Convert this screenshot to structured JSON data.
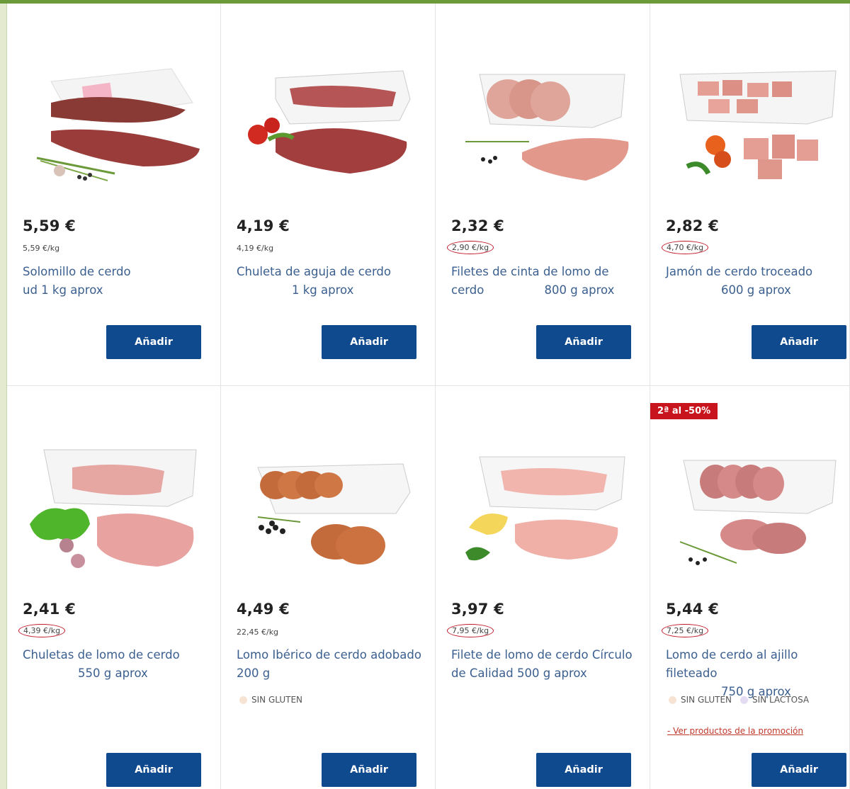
{
  "products": [
    {
      "price": "5,59 €",
      "unit_price": "5,59 €/kg",
      "name_line1": "Solomillo de cerdo",
      "name_line2": "ud 1 kg aprox",
      "add_label": "Añadir"
    },
    {
      "price": "4,19 €",
      "unit_price": "4,19 €/kg",
      "name_line1": "Chuleta de aguja de cerdo",
      "name_line2": "1 kg aprox",
      "add_label": "Añadir"
    },
    {
      "price": "2,32 €",
      "unit_price": "2,90 €/kg",
      "name_line1": "Filetes de cinta de lomo de",
      "name_line2a": "cerdo",
      "name_line2b": "800 g aprox",
      "add_label": "Añadir"
    },
    {
      "price": "2,82 €",
      "unit_price": "4,70 €/kg",
      "name_line1": "Jamón de cerdo troceado",
      "name_line2": "600 g aprox",
      "add_label": "Añadir"
    },
    {
      "price": "2,41 €",
      "unit_price": "4,39 €/kg",
      "name_line1": "Chuletas de lomo de cerdo",
      "name_line2": "550 g aprox",
      "add_label": "Añadir"
    },
    {
      "price": "4,49 €",
      "unit_price": "22,45 €/kg",
      "name_line1": "Lomo Ibérico de cerdo adobado",
      "name_line2": "200 g",
      "tag1": "SIN GLUTEN",
      "add_label": "Añadir"
    },
    {
      "price": "3,97 €",
      "unit_price": "7,95 €/kg",
      "name_line1": "Filete de lomo de cerdo Círculo",
      "name_line2": "de Calidad 500 g aprox",
      "add_label": "Añadir"
    },
    {
      "price": "5,44 €",
      "unit_price": "7,25 €/kg",
      "name_line1": "Lomo de cerdo al ajillo fileteado",
      "name_line2": "750 g aprox",
      "tag1": "SIN GLUTEN",
      "tag2": "SIN LACTOSA",
      "badge": "2ª al -50%",
      "promo_link": "- Ver productos de la promoción",
      "add_label": "Añadir"
    }
  ],
  "colors": {
    "button": "#104a8e",
    "name": "#3b5f8f",
    "badge": "#c8141c",
    "annotation": "#c01a2a",
    "top_bar": "#6b9a3a",
    "sin_gluten_dot": "#f6e3d4",
    "sin_lactosa_dot": "#e4dcf2"
  }
}
